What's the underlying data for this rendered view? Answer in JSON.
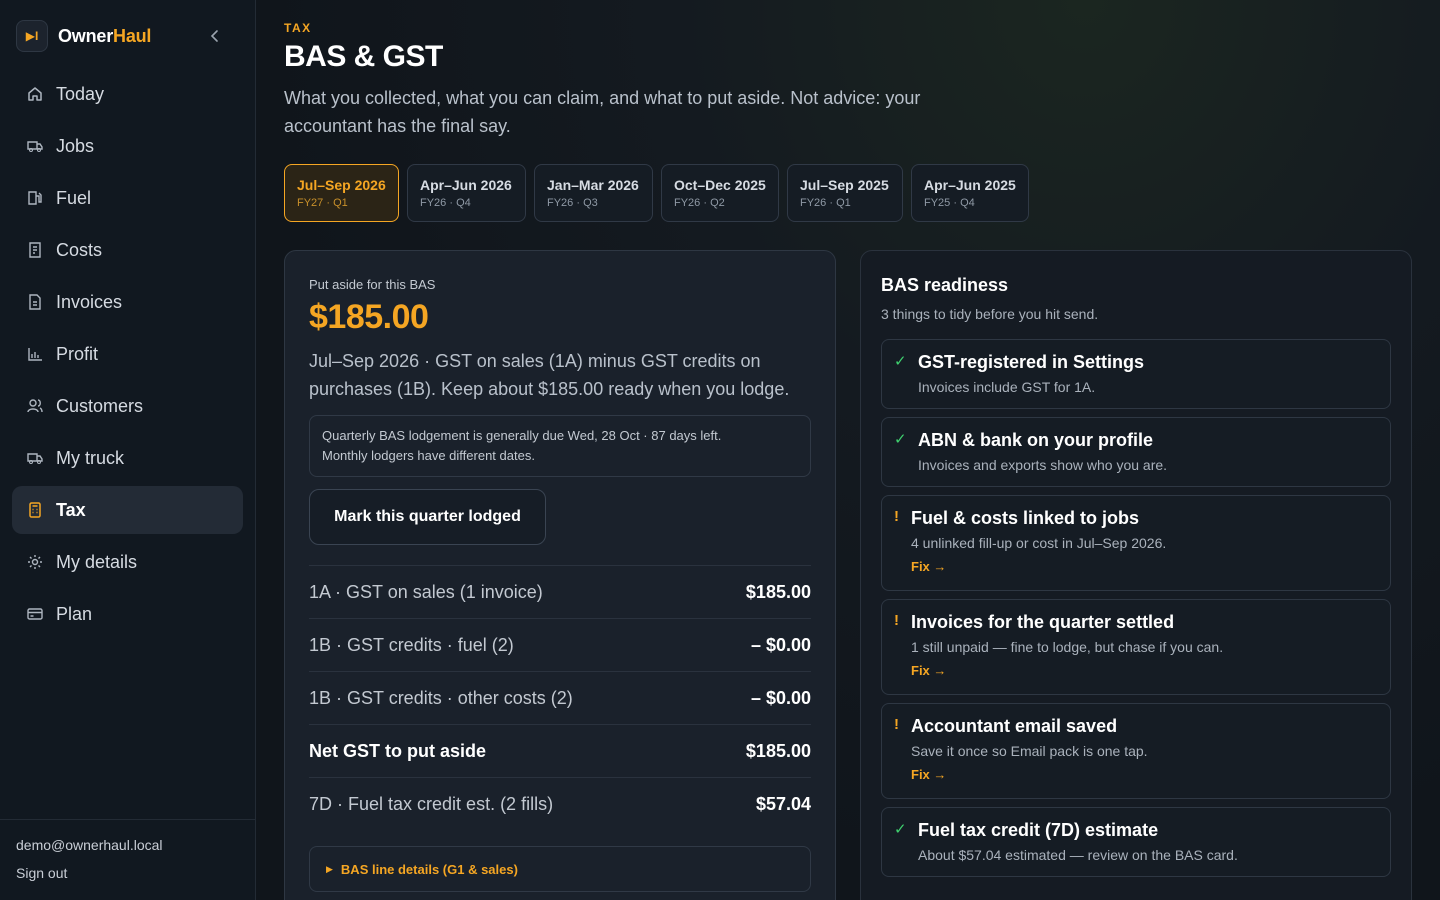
{
  "brand": {
    "logo_text": "▶I",
    "name_part1": "Owner",
    "name_part2": "Haul"
  },
  "nav": [
    {
      "label": "Today",
      "icon": "home-icon"
    },
    {
      "label": "Jobs",
      "icon": "truck-icon"
    },
    {
      "label": "Fuel",
      "icon": "fuel-icon"
    },
    {
      "label": "Costs",
      "icon": "receipt-icon"
    },
    {
      "label": "Invoices",
      "icon": "document-icon"
    },
    {
      "label": "Profit",
      "icon": "bar-chart-icon"
    },
    {
      "label": "Customers",
      "icon": "users-icon"
    },
    {
      "label": "My truck",
      "icon": "truck-icon"
    },
    {
      "label": "Tax",
      "icon": "calculator-icon",
      "active": true
    },
    {
      "label": "My details",
      "icon": "gear-icon"
    },
    {
      "label": "Plan",
      "icon": "credit-card-icon"
    }
  ],
  "footer": {
    "email": "demo@ownerhaul.local",
    "signout": "Sign out"
  },
  "header": {
    "eyebrow": "TAX",
    "title": "BAS & GST",
    "subtitle": "What you collected, what you can claim, and what to put aside. Not advice: your accountant has the final say."
  },
  "periods": [
    {
      "label": "Jul–Sep 2026",
      "sub": "FY27 · Q1",
      "active": true
    },
    {
      "label": "Apr–Jun 2026",
      "sub": "FY26 · Q4"
    },
    {
      "label": "Jan–Mar 2026",
      "sub": "FY26 · Q3"
    },
    {
      "label": "Oct–Dec 2025",
      "sub": "FY26 · Q2"
    },
    {
      "label": "Jul–Sep 2025",
      "sub": "FY26 · Q1"
    },
    {
      "label": "Apr–Jun 2025",
      "sub": "FY25 · Q4"
    }
  ],
  "bas": {
    "label": "Put aside for this BAS",
    "amount": "$185.00",
    "description": "Jul–Sep 2026 · GST on sales (1A) minus GST credits on purchases (1B). Keep about $185.00 ready when you lodge.",
    "due_line1": "Quarterly BAS lodgement is generally due Wed, 28 Oct · 87 days left.",
    "due_line2": "Monthly lodgers have different dates.",
    "lodge_button": "Mark this quarter lodged",
    "lines": [
      {
        "label": "1A · GST on sales (1 invoice)",
        "value": "$185.00"
      },
      {
        "label": "1B · GST credits · fuel (2)",
        "value": "– $0.00"
      },
      {
        "label": "1B · GST credits · other costs (2)",
        "value": "– $0.00"
      },
      {
        "label": "Net GST to put aside",
        "value": "$185.00",
        "bold": true
      },
      {
        "label": "7D · Fuel tax credit est. (2 fills)",
        "value": "$57.04"
      }
    ],
    "details_toggle": "BAS line details (G1 & sales)"
  },
  "readiness": {
    "title": "BAS readiness",
    "subtitle": "3 things to tidy before you hit send.",
    "fix_label": "Fix →",
    "items": [
      {
        "status": "ok",
        "mark": "✓",
        "title": "GST-registered in Settings",
        "desc": "Invoices include GST for 1A."
      },
      {
        "status": "ok",
        "mark": "✓",
        "title": "ABN & bank on your profile",
        "desc": "Invoices and exports show who you are."
      },
      {
        "status": "warn",
        "mark": "!",
        "title": "Fuel & costs linked to jobs",
        "desc": "4 unlinked fill-up or cost in Jul–Sep 2026."
      },
      {
        "status": "warn",
        "mark": "!",
        "title": "Invoices for the quarter settled",
        "desc": "1 still unpaid — fine to lodge, but chase if you can."
      },
      {
        "status": "warn",
        "mark": "!",
        "title": "Accountant email saved",
        "desc": "Save it once so Email pack is one tap."
      },
      {
        "status": "ok",
        "mark": "✓",
        "title": "Fuel tax credit (7D) estimate",
        "desc": "About $57.04 estimated — review on the BAS card."
      }
    ]
  },
  "colors": {
    "accent": "#f5a623",
    "ok": "#3ecf6e",
    "background": "#0f141b"
  }
}
